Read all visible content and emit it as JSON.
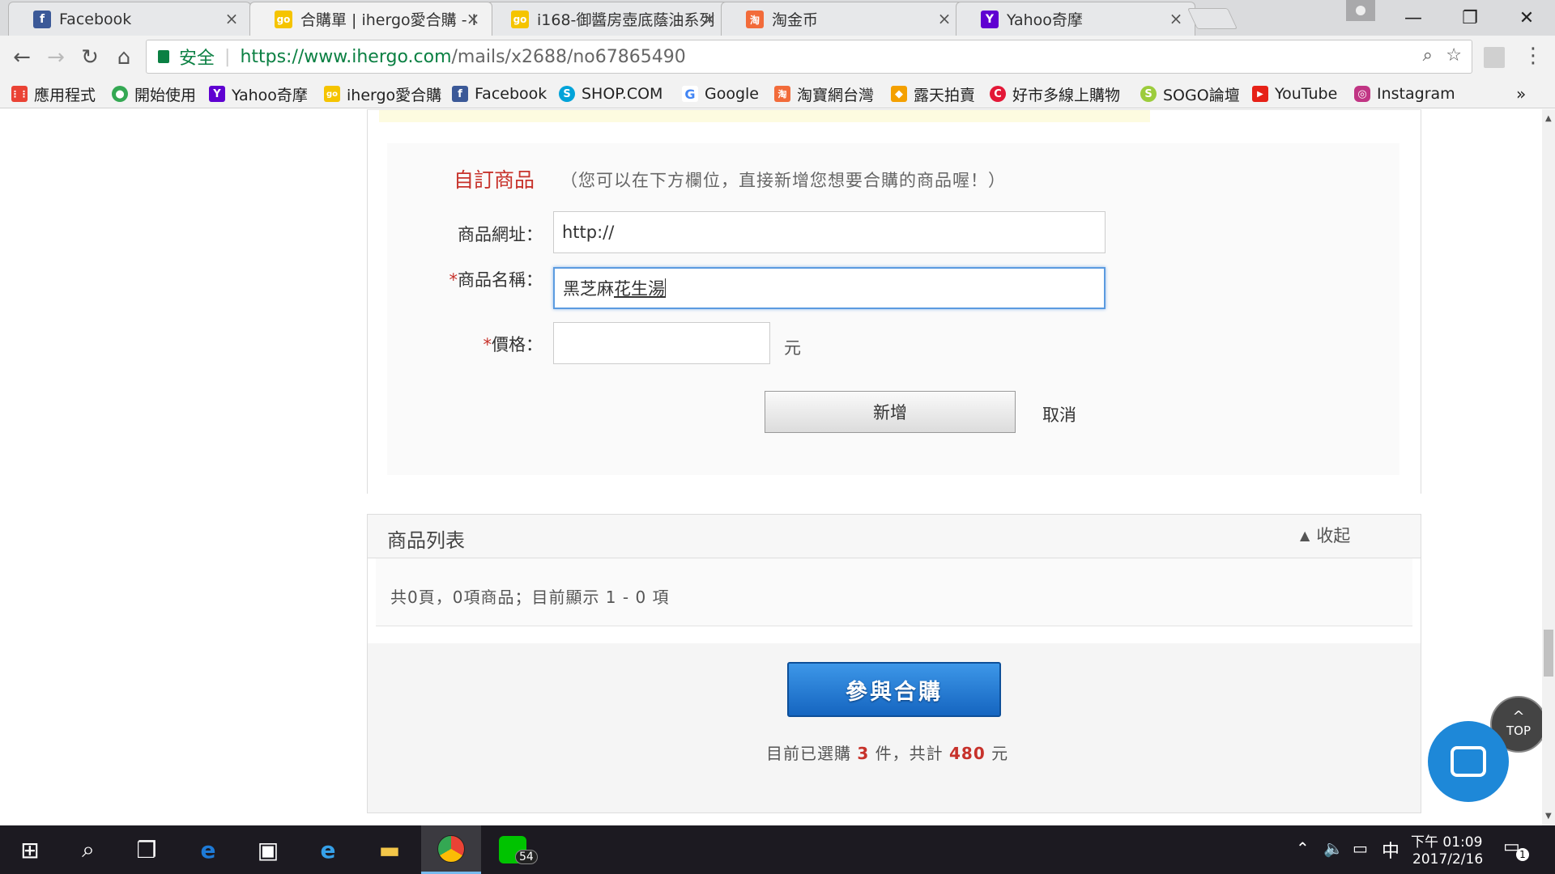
{
  "browser": {
    "tabs": [
      {
        "title": "Facebook",
        "icon": "facebook-icon",
        "color": "#3b5998",
        "glyph": "f"
      },
      {
        "title": "合購單 | ihergo愛合購 - I",
        "icon": "ihergo-icon",
        "color": "#f5c400",
        "glyph": "go"
      },
      {
        "title": "i168-御醬房壺底蔭油系列",
        "icon": "ihergo-icon",
        "color": "#f5c400",
        "glyph": "go"
      },
      {
        "title": "淘金币",
        "icon": "taobao-icon",
        "color": "#f26b3a",
        "glyph": "淘"
      },
      {
        "title": "Yahoo奇摩",
        "icon": "yahoo-icon",
        "color": "#5f01d1",
        "glyph": "Y"
      }
    ],
    "close_glyph": "×",
    "security_label": "安全",
    "url_host": "https://www.ihergo.com",
    "url_path": "/mails/x2688/no67865490",
    "bookmarks": [
      {
        "label": "應用程式",
        "icon": "apps-grid-icon",
        "color": "#4285f4",
        "glyph": "⋮⋮"
      },
      {
        "label": "開始使用",
        "icon": "chrome-icon",
        "color": "#34a853",
        "glyph": "●"
      },
      {
        "label": "Yahoo奇摩",
        "icon": "yahoo-icon",
        "color": "#5f01d1",
        "glyph": "Y"
      },
      {
        "label": "ihergo愛合購",
        "icon": "ihergo-icon",
        "color": "#f5c400",
        "glyph": "go"
      },
      {
        "label": "Facebook",
        "icon": "facebook-icon",
        "color": "#3b5998",
        "glyph": "f"
      },
      {
        "label": "SHOP.COM",
        "icon": "shopcom-icon",
        "color": "#00a3d9",
        "glyph": "S"
      },
      {
        "label": "Google",
        "icon": "google-icon",
        "color": "#ffffff",
        "glyph": "G"
      },
      {
        "label": "淘寶網台灣",
        "icon": "taobao-icon",
        "color": "#f26b3a",
        "glyph": "淘"
      },
      {
        "label": "露天拍賣",
        "icon": "ruten-icon",
        "color": "#f4a000",
        "glyph": "◆"
      },
      {
        "label": "好市多線上購物",
        "icon": "costco-icon",
        "color": "#e31837",
        "glyph": "C"
      },
      {
        "label": "SOGO論壇",
        "icon": "sogo-icon",
        "color": "#9ccc3c",
        "glyph": "S"
      },
      {
        "label": "YouTube",
        "icon": "youtube-icon",
        "color": "#e62117",
        "glyph": "▶"
      },
      {
        "label": "Instagram",
        "icon": "instagram-icon",
        "color": "#c13584",
        "glyph": "◎"
      }
    ],
    "bookmarks_more": "»"
  },
  "form": {
    "section_title": "自訂商品",
    "section_hint": "（您可以在下方欄位，直接新增您想要合購的商品喔！）",
    "url_label": "商品網址：",
    "url_value": "http://",
    "name_required": "*",
    "name_label": "商品名稱：",
    "name_value_plain": "黑芝麻",
    "name_value_composing": "花生湯",
    "price_required": "*",
    "price_label": "價格：",
    "price_value": "",
    "price_unit": "元",
    "add_button": "新增",
    "cancel_link": "取消"
  },
  "product_list": {
    "title": "商品列表",
    "collapse_label": "收起",
    "summary": "共0頁，0項商品；目前顯示 1 - 0 項"
  },
  "join": {
    "button": "參與合購",
    "status_prefix": "目前已選購",
    "count": "3",
    "status_mid": "件，共計",
    "total": "480",
    "status_suffix": "元"
  },
  "floating": {
    "top_label": "TOP"
  },
  "taskbar": {
    "time": "下午 01:09",
    "date": "2017/2/16",
    "ime": "中",
    "line_badge": "54",
    "notification_badge": "1"
  },
  "colors": {
    "accent_red": "#c7322b",
    "join_blue": "#1a73c8",
    "chat_blue": "#1e88d8"
  }
}
